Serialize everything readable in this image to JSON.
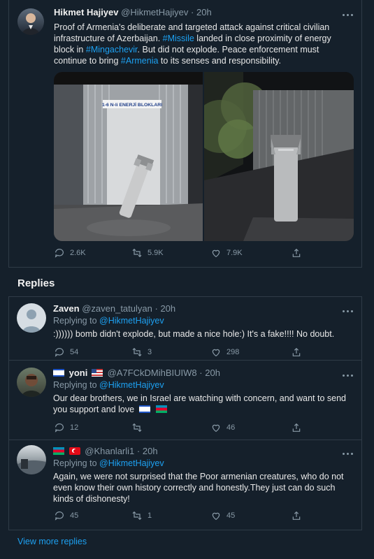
{
  "main_tweet": {
    "name": "Hikmet Hajiyev",
    "handle": "@HikmetHajiyev",
    "time": "20h",
    "text_1": "Proof of Armenia's deliberate and targeted attack against critical civilian infrastructure of Azerbaijan.",
    "hashtag_1": "#Missile",
    "text_2": "landed in close proximity of energy block in",
    "hashtag_2": "#Mingachevir",
    "text_3": ". But did not explode. Peace enforcement must continue to bring",
    "hashtag_3": "#Armenia",
    "text_4": "to its senses and responsibility.",
    "image_sign": "1-6 N-li ENERJİ BLOKLARI",
    "replies": "2.6K",
    "retweets": "5.9K",
    "likes": "7.9K"
  },
  "replies_title": "Replies",
  "replies": [
    {
      "name": "Zaven",
      "handle": "@zaven_tatulyan",
      "time": "20h",
      "replying_to_label": "Replying to",
      "replying_to": "@HikmetHajiyev",
      "text": ":)))))) bomb didn't explode, but made a nice hole:) It's a fake!!!! No doubt.",
      "replies": "54",
      "retweets": "3",
      "likes": "298"
    },
    {
      "name": "yoni",
      "handle": "@A7FCkDMihBIUIW8",
      "time": "20h",
      "replying_to_label": "Replying to",
      "replying_to": "@HikmetHajiyev",
      "text": "Our dear brothers, we in Israel are watching with concern, and want to send you support and love",
      "replies": "12",
      "retweets": "",
      "likes": "46"
    },
    {
      "name": "",
      "handle": "@Khanlarli1",
      "time": "20h",
      "replying_to_label": "Replying to",
      "replying_to": "@HikmetHajiyev",
      "text": "Again, we were not surprised that the Poor armenian creatures, who do not even know their own history correctly and honestly.They just can do such kinds of dishonesty!",
      "replies": "45",
      "retweets": "1",
      "likes": "45"
    }
  ],
  "view_more": "View more replies",
  "colors": {
    "background": "#15202b",
    "link": "#1da1f2",
    "muted": "#8899a6",
    "border": "#2f3b47"
  }
}
